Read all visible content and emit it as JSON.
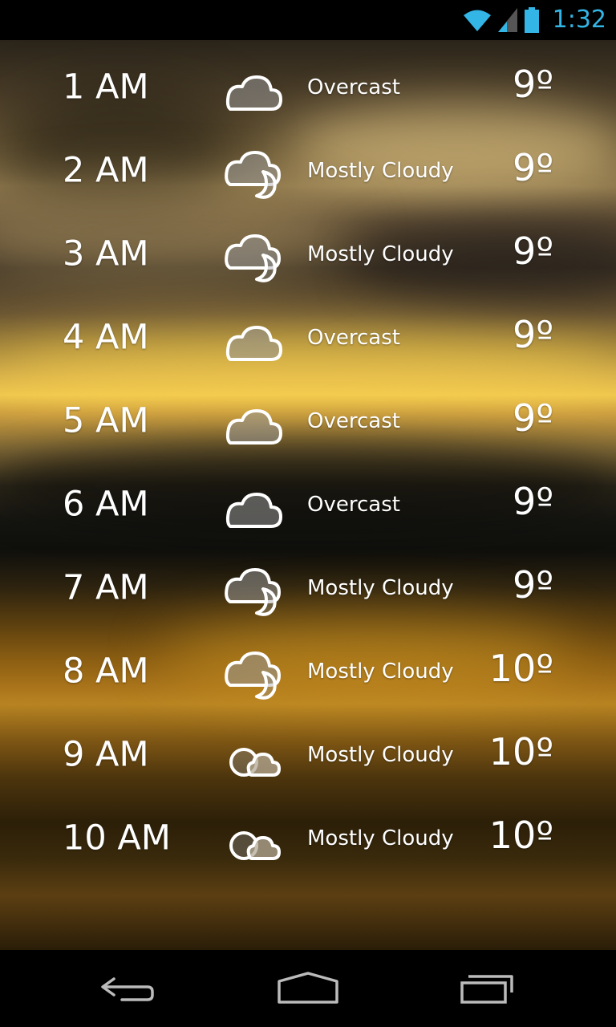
{
  "status_bar": {
    "time": "1:32",
    "accent_color": "#33b5e5",
    "icons": [
      "wifi-icon",
      "cell-signal-icon",
      "battery-icon"
    ]
  },
  "forecast": [
    {
      "hour": "1 AM",
      "condition": "Overcast",
      "temp": "9º",
      "icon": "overcast-icon"
    },
    {
      "hour": "2 AM",
      "condition": "Mostly Cloudy",
      "temp": "9º",
      "icon": "mostly-cloudy-night-icon"
    },
    {
      "hour": "3 AM",
      "condition": "Mostly Cloudy",
      "temp": "9º",
      "icon": "mostly-cloudy-night-icon"
    },
    {
      "hour": "4 AM",
      "condition": "Overcast",
      "temp": "9º",
      "icon": "overcast-icon"
    },
    {
      "hour": "5 AM",
      "condition": "Overcast",
      "temp": "9º",
      "icon": "overcast-icon"
    },
    {
      "hour": "6 AM",
      "condition": "Overcast",
      "temp": "9º",
      "icon": "overcast-icon"
    },
    {
      "hour": "7 AM",
      "condition": "Mostly Cloudy",
      "temp": "9º",
      "icon": "mostly-cloudy-night-icon"
    },
    {
      "hour": "8 AM",
      "condition": "Mostly Cloudy",
      "temp": "10º",
      "icon": "mostly-cloudy-night-icon"
    },
    {
      "hour": "9 AM",
      "condition": "Mostly Cloudy",
      "temp": "10º",
      "icon": "mostly-cloudy-day-icon"
    },
    {
      "hour": "10 AM",
      "condition": "Mostly Cloudy",
      "temp": "10º",
      "icon": "mostly-cloudy-day-icon"
    }
  ],
  "nav_bar": {
    "icons": [
      "back-icon",
      "home-icon",
      "recent-apps-icon"
    ]
  }
}
